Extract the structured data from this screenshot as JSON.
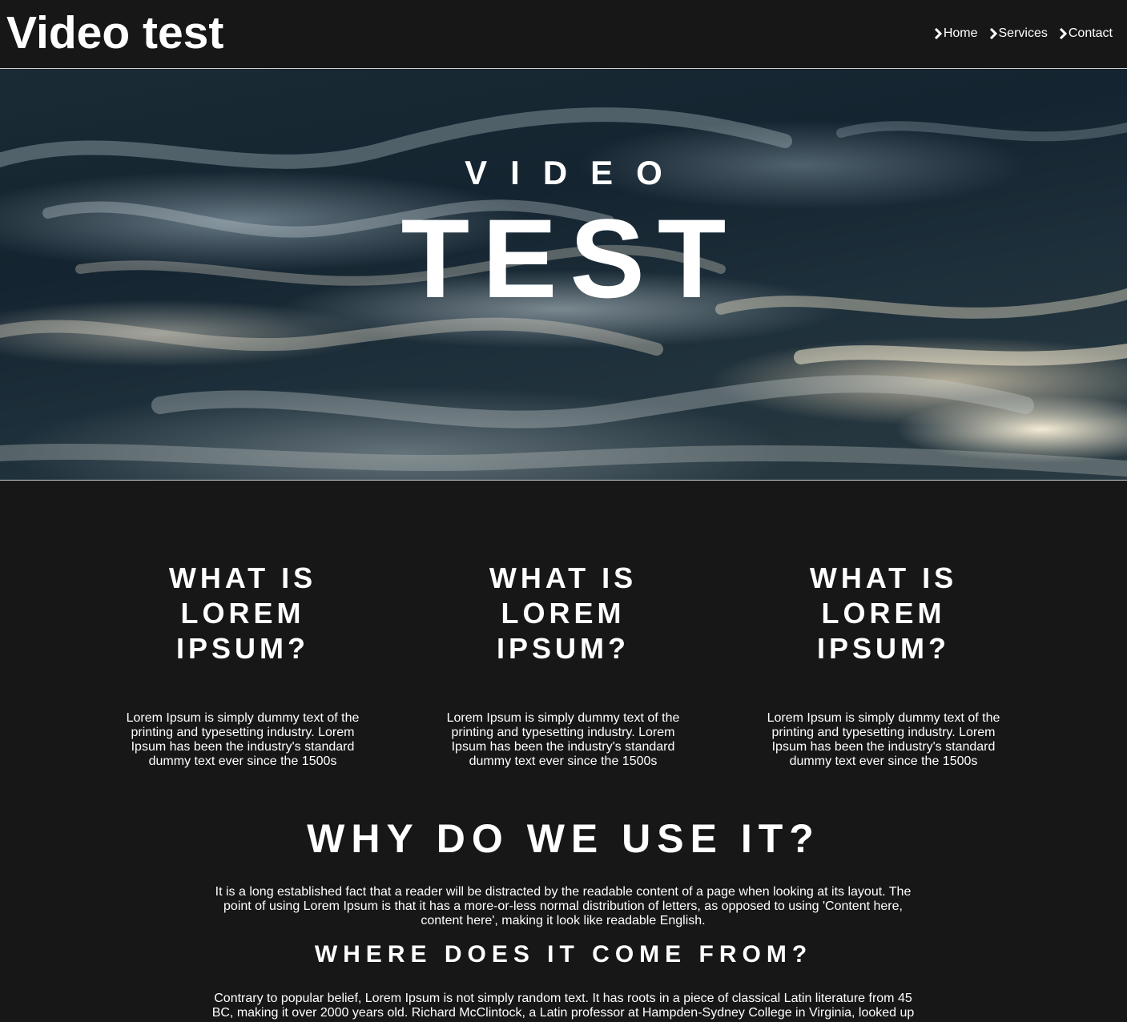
{
  "header": {
    "site_title": "Video test",
    "nav": [
      {
        "label": "Home",
        "icon": "chevron-right-icon"
      },
      {
        "label": "Services",
        "icon": "chevron-right-icon"
      },
      {
        "label": "Contact",
        "icon": "chevron-right-icon"
      }
    ]
  },
  "hero": {
    "subtitle": "VIDEO",
    "title": "TEST"
  },
  "columns": [
    {
      "heading": "WHAT IS LOREM IPSUM?",
      "text": "Lorem Ipsum is simply dummy text of the printing and typesetting industry. Lorem Ipsum has been the industry's standard dummy text ever since the 1500s"
    },
    {
      "heading": "WHAT IS LOREM IPSUM?",
      "text": "Lorem Ipsum is simply dummy text of the printing and typesetting industry. Lorem Ipsum has been the industry's standard dummy text ever since the 1500s"
    },
    {
      "heading": "WHAT IS LOREM IPSUM?",
      "text": "Lorem Ipsum is simply dummy text of the printing and typesetting industry. Lorem Ipsum has been the industry's standard dummy text ever since the 1500s"
    }
  ],
  "why": {
    "heading": "WHY DO WE USE IT?",
    "text": "It is a long established fact that a reader will be distracted by the readable content of a page when looking at its layout. The point of using Lorem Ipsum is that it has a more-or-less normal distribution of letters, as opposed to using 'Content here, content here', making it look like readable English."
  },
  "where": {
    "heading": "WHERE DOES IT COME FROM?",
    "text": "Contrary to popular belief, Lorem Ipsum is not simply random text. It has roots in a piece of classical Latin literature from 45 BC, making it over 2000 years old. Richard McClintock, a Latin professor at Hampden-Sydney College in Virginia, looked up"
  },
  "colors": {
    "background": "#171717",
    "text": "#ffffff",
    "divider": "#cfcfcf"
  }
}
